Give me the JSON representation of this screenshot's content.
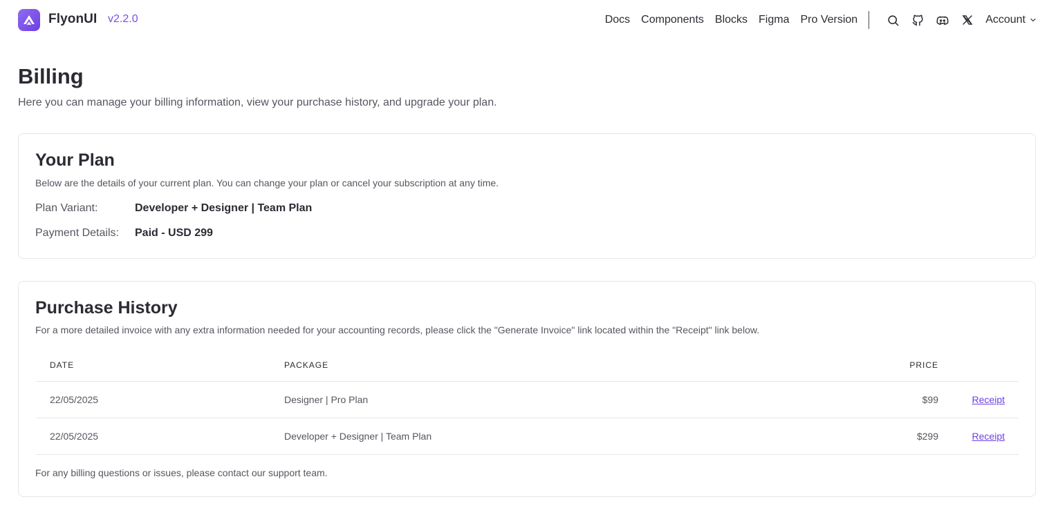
{
  "header": {
    "brand": "FlyonUI",
    "version": "v2.2.0",
    "nav": [
      "Docs",
      "Components",
      "Blocks",
      "Figma",
      "Pro Version"
    ],
    "icons": [
      "search-icon",
      "github-icon",
      "discord-icon",
      "x-twitter-icon"
    ],
    "account_label": "Account"
  },
  "page": {
    "title": "Billing",
    "subtitle": "Here you can manage your billing information, view your purchase history, and upgrade your plan."
  },
  "plan": {
    "title": "Your Plan",
    "description": "Below are the details of your current plan. You can change your plan or cancel your subscription at any time.",
    "variant_label": "Plan Variant:",
    "variant_value": "Developer + Designer | Team Plan",
    "payment_label": "Payment Details:",
    "payment_value": "Paid - USD 299"
  },
  "history": {
    "title": "Purchase History",
    "description": "For a more detailed invoice with any extra information needed for your accounting records, please click the \"Generate Invoice\" link located within the \"Receipt\" link below.",
    "columns": [
      "DATE",
      "PACKAGE",
      "PRICE"
    ],
    "rows": [
      {
        "date": "22/05/2025",
        "package": "Designer | Pro Plan",
        "price": "$99",
        "action": "Receipt"
      },
      {
        "date": "22/05/2025",
        "package": "Developer + Designer | Team Plan",
        "price": "$299",
        "action": "Receipt"
      }
    ],
    "footer": "For any billing questions or issues, please contact our support team."
  },
  "colors": {
    "accent": "#6d3fe3",
    "text": "#2b2b33",
    "muted": "#55555f",
    "border": "#e6e6ea"
  }
}
